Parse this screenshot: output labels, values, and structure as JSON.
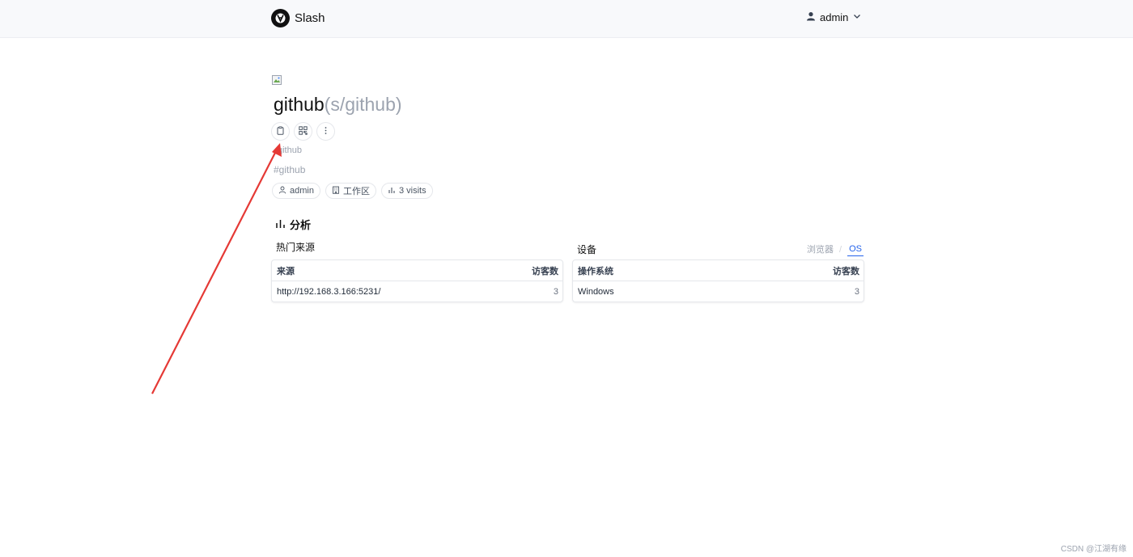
{
  "header": {
    "brand_name": "Slash",
    "user_name": "admin"
  },
  "shortcut": {
    "name": "github",
    "slug": "(s/github)",
    "description": "github",
    "tag": "#github",
    "creator": "admin",
    "visibility": "工作区",
    "visits": "3 visits",
    "actions": [
      "clipboard-icon",
      "qrcode-icon",
      "more-vertical-icon"
    ]
  },
  "analytics": {
    "section_title": "分析",
    "referrers": {
      "title": "热门来源",
      "columns": [
        "来源",
        "访客数"
      ],
      "rows": [
        {
          "source": "http://192.168.3.166:5231/",
          "count": "3"
        }
      ]
    },
    "devices": {
      "title": "设备",
      "tabs": [
        "浏览器",
        "OS"
      ],
      "active_tab": "OS",
      "columns": [
        "操作系统",
        "访客数"
      ],
      "rows": [
        {
          "os": "Windows",
          "count": "3"
        }
      ]
    }
  },
  "annotation": {
    "arrow_color": "#e53935"
  },
  "watermark": "CSDN @江湖有缘"
}
